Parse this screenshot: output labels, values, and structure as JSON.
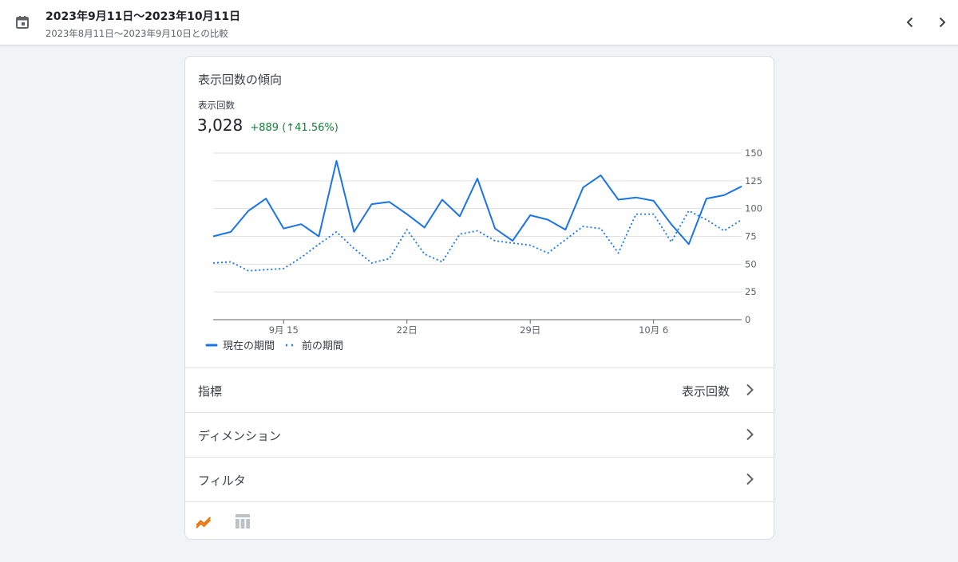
{
  "header": {
    "date_range": "2023年9月11日〜2023年10月11日",
    "compare_range": "2023年8月11日〜2023年9月10日との比較",
    "icons": {
      "calendar": "calendar-icon",
      "prev": "chevron-left-icon",
      "next": "chevron-right-icon"
    }
  },
  "card": {
    "title": "表示回数の傾向",
    "metric_label": "表示回数",
    "metric_value": "3,028",
    "metric_delta": "+889 (↑41.56%)"
  },
  "chart_data": {
    "type": "line",
    "x_tick_labels": [
      "9月 15",
      "22日",
      "29日",
      "10月 6"
    ],
    "x_tick_days": [
      4,
      11,
      18,
      25
    ],
    "y_ticks": [
      0,
      25,
      50,
      75,
      100,
      125,
      150
    ],
    "ylim": [
      0,
      150
    ],
    "grid": true,
    "legend_position": "bottom-left",
    "series": [
      {
        "name": "現在の期間",
        "style": "solid",
        "color": "#1a73e8",
        "values": [
          75,
          79,
          98,
          109,
          82,
          86,
          75,
          143,
          79,
          104,
          106,
          95,
          83,
          108,
          93,
          127,
          82,
          71,
          94,
          90,
          81,
          119,
          130,
          108,
          110,
          107,
          86,
          68,
          109,
          112,
          120
        ]
      },
      {
        "name": "前の期間",
        "style": "dotted",
        "color": "#1a73e8",
        "values": [
          51,
          52,
          44,
          45,
          46,
          56,
          68,
          79,
          64,
          51,
          55,
          81,
          59,
          52,
          77,
          80,
          71,
          69,
          67,
          60,
          72,
          84,
          82,
          60,
          95,
          95,
          70,
          98,
          90,
          80,
          90
        ]
      }
    ]
  },
  "rows": [
    {
      "label": "指標",
      "value": "表示回数"
    },
    {
      "label": "ディメンション",
      "value": ""
    },
    {
      "label": "フィルタ",
      "value": ""
    }
  ],
  "bottom_bar": {
    "icons": [
      "line-chart-icon",
      "table-icon"
    ],
    "active_color": "#e8710a",
    "inactive_color": "#bdc1c6"
  }
}
